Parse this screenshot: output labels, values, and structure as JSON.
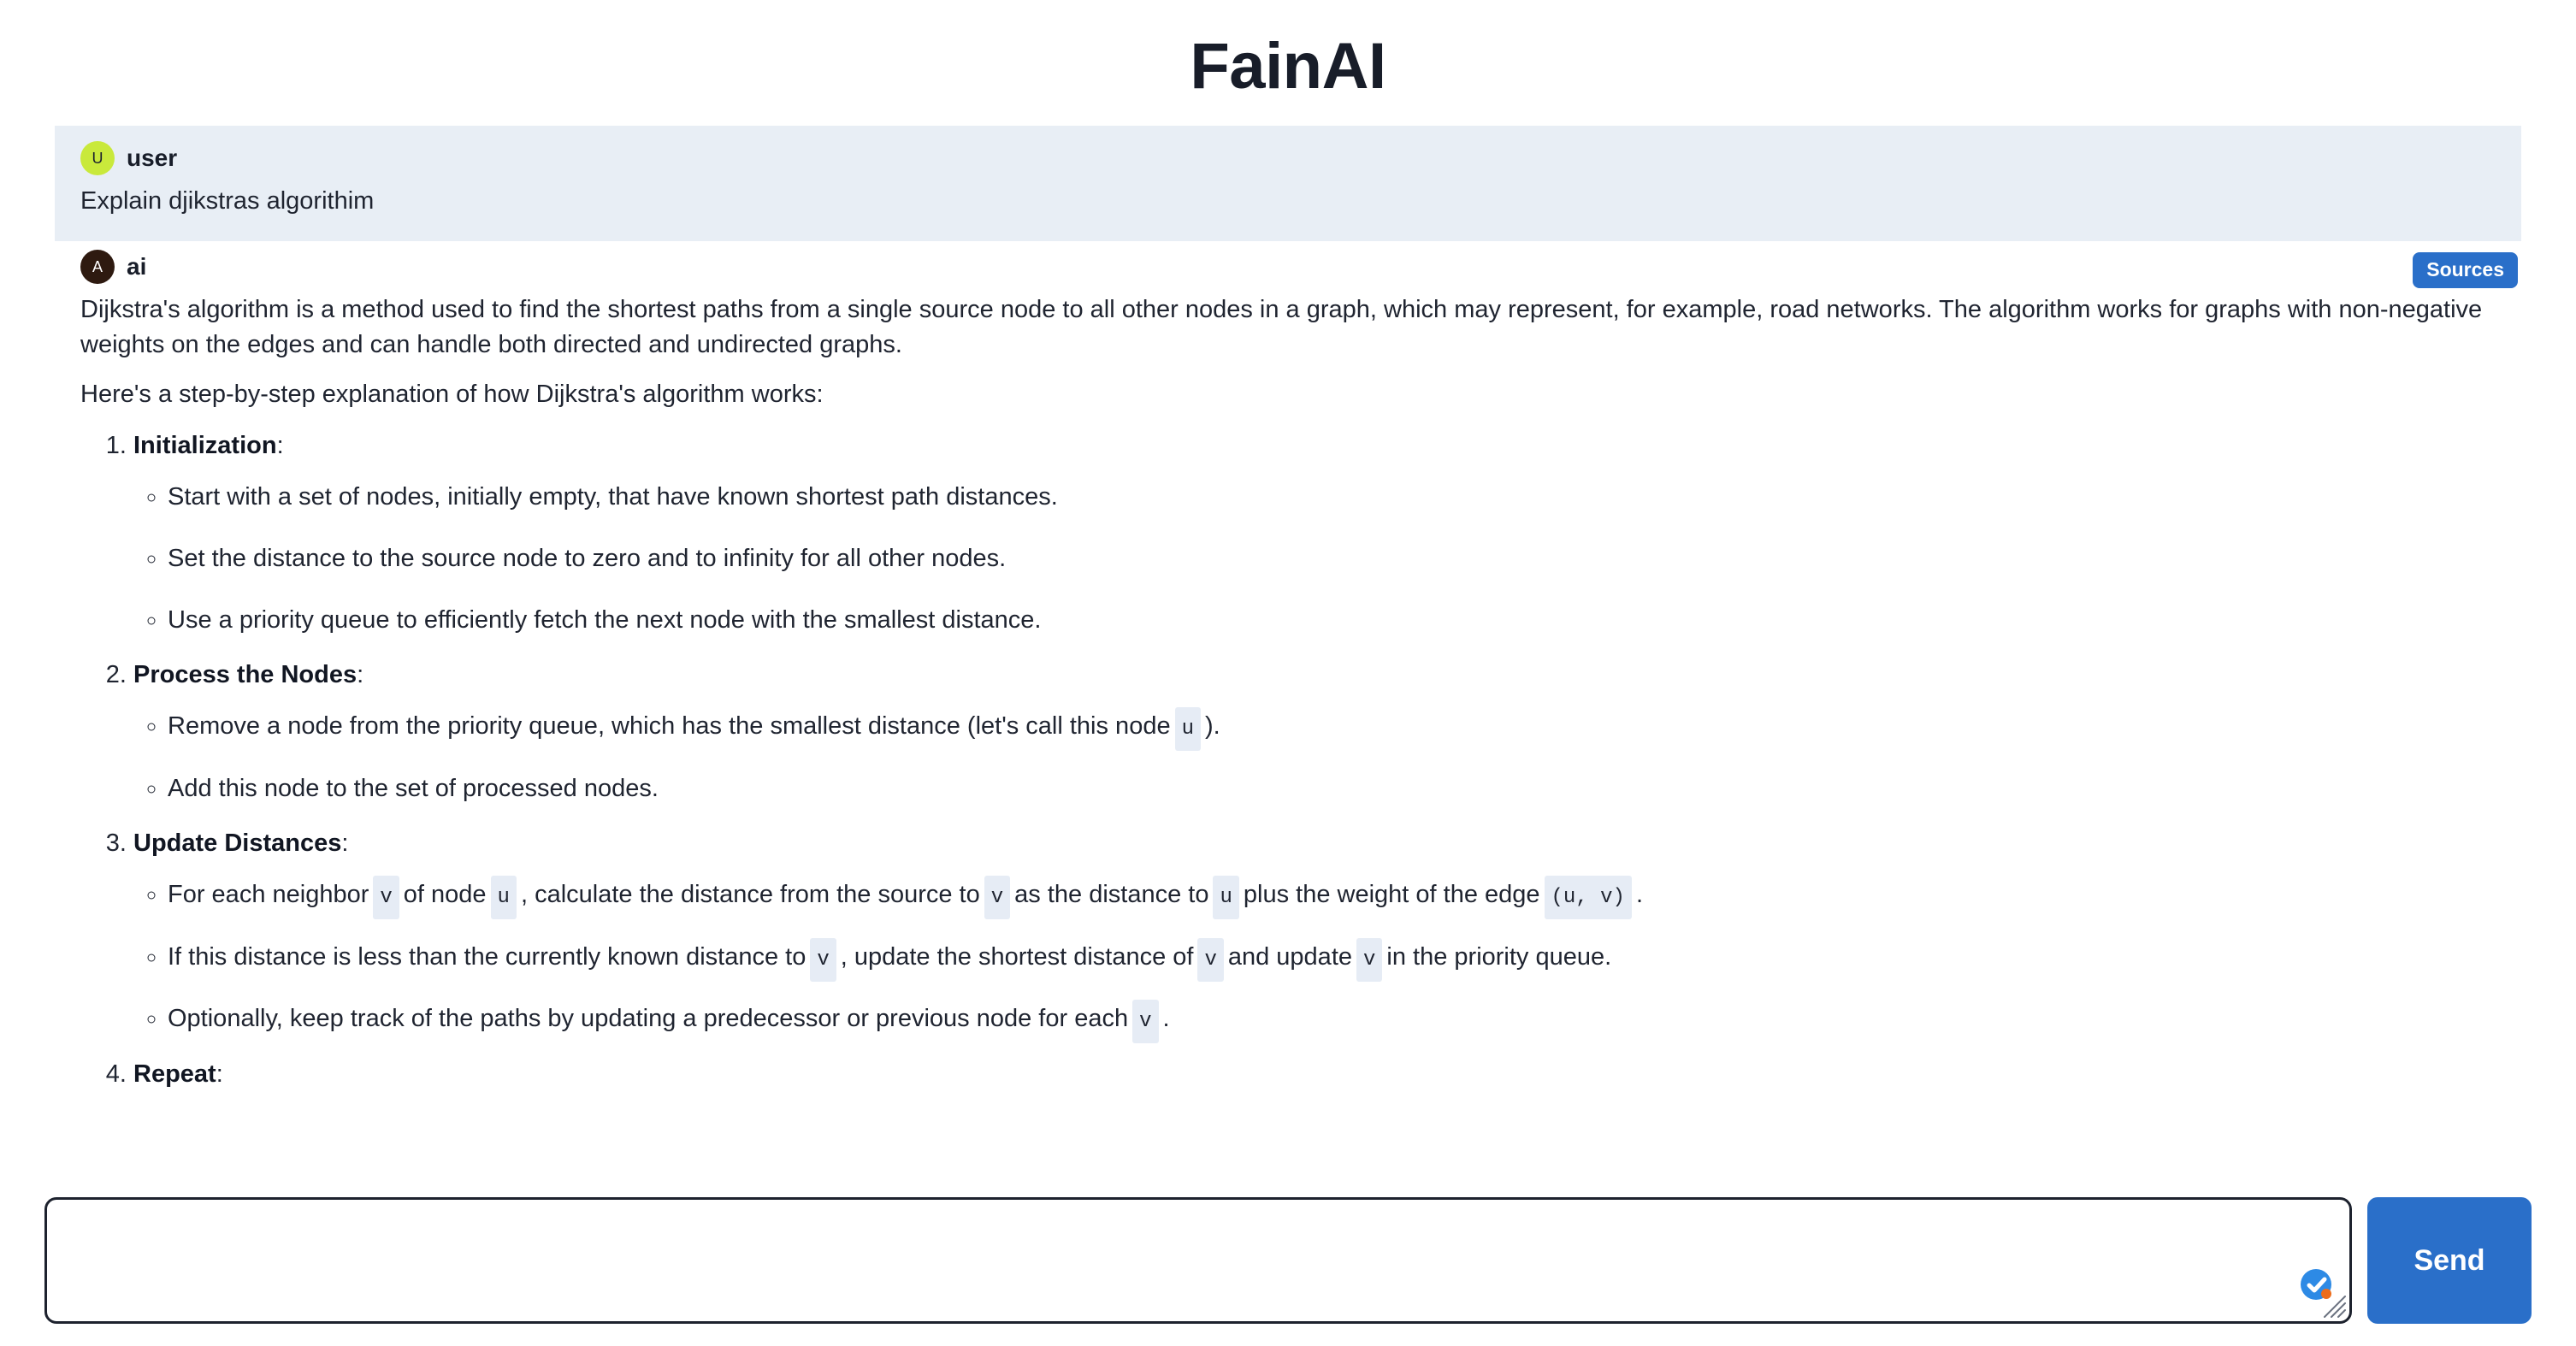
{
  "app": {
    "title": "FainAI"
  },
  "messages": [
    {
      "role_label": "user",
      "avatar_letter": "U",
      "avatar_color": "#c9e93b",
      "text": "Explain djikstras algorithim"
    },
    {
      "role_label": "ai",
      "avatar_letter": "A",
      "avatar_color": "#2e1a10",
      "sources_label": "Sources"
    }
  ],
  "answer": {
    "paragraph_1": "Dijkstra's algorithm is a method used to find the shortest paths from a single source node to all other nodes in a graph, which may represent, for example, road networks. The algorithm works for graphs with non-negative weights on the edges and can handle both directed and undirected graphs.",
    "paragraph_2": "Here's a step-by-step explanation of how Dijkstra's algorithm works:",
    "steps": [
      {
        "title": "Initialization",
        "colon": ":",
        "bullets": [
          {
            "parts": [
              {
                "t": "text",
                "v": "Start with a set of nodes, initially empty, that have known shortest path distances."
              }
            ]
          },
          {
            "parts": [
              {
                "t": "text",
                "v": "Set the distance to the source node to zero and to infinity for all other nodes."
              }
            ]
          },
          {
            "parts": [
              {
                "t": "text",
                "v": "Use a priority queue to efficiently fetch the next node with the smallest distance."
              }
            ]
          }
        ]
      },
      {
        "title": "Process the Nodes",
        "colon": ":",
        "bullets": [
          {
            "parts": [
              {
                "t": "text",
                "v": "Remove a node from the priority queue, which has the smallest distance (let's call this node"
              },
              {
                "t": "code",
                "v": "u"
              },
              {
                "t": "text",
                "v": ")."
              }
            ]
          },
          {
            "parts": [
              {
                "t": "text",
                "v": "Add this node to the set of processed nodes."
              }
            ]
          }
        ]
      },
      {
        "title": "Update Distances",
        "colon": ":",
        "bullets": [
          {
            "parts": [
              {
                "t": "text",
                "v": "For each neighbor"
              },
              {
                "t": "code",
                "v": "v"
              },
              {
                "t": "text",
                "v": "of node"
              },
              {
                "t": "code",
                "v": "u"
              },
              {
                "t": "text",
                "v": ", calculate the distance from the source to"
              },
              {
                "t": "code",
                "v": "v"
              },
              {
                "t": "text",
                "v": "as the distance to"
              },
              {
                "t": "code",
                "v": "u"
              },
              {
                "t": "text",
                "v": "plus the weight of the edge"
              },
              {
                "t": "code",
                "v": "(u, v)"
              },
              {
                "t": "text",
                "v": "."
              }
            ]
          },
          {
            "parts": [
              {
                "t": "text",
                "v": "If this distance is less than the currently known distance to"
              },
              {
                "t": "code",
                "v": "v"
              },
              {
                "t": "text",
                "v": ", update the shortest distance of"
              },
              {
                "t": "code",
                "v": "v"
              },
              {
                "t": "text",
                "v": "and update"
              },
              {
                "t": "code",
                "v": "v"
              },
              {
                "t": "text",
                "v": "in the priority queue."
              }
            ]
          },
          {
            "parts": [
              {
                "t": "text",
                "v": "Optionally, keep track of the paths by updating a predecessor or previous node for each"
              },
              {
                "t": "code",
                "v": "v"
              },
              {
                "t": "text",
                "v": "."
              }
            ]
          }
        ]
      },
      {
        "title": "Repeat",
        "colon": ":",
        "bullets": []
      }
    ]
  },
  "composer": {
    "input_value": "",
    "input_placeholder": "",
    "send_label": "Send",
    "send_color": "#2a6fc9",
    "badge_icon": "check-circle-icon",
    "resize_icon": "resize-grip-icon"
  }
}
